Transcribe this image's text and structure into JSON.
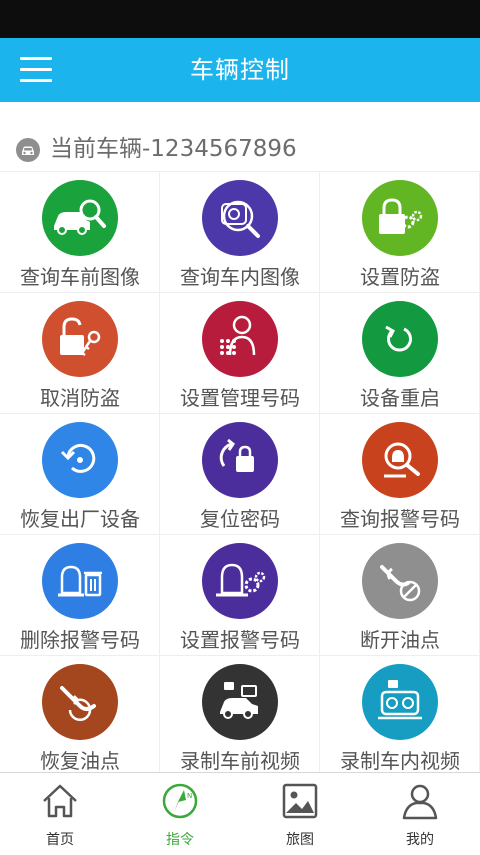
{
  "header": {
    "title": "车辆控制"
  },
  "vehicle": {
    "label": "当前车辆-1234567896"
  },
  "commands": [
    {
      "label": "查询车前图像",
      "icon": "car-magnify-icon",
      "color": "#1aa33c"
    },
    {
      "label": "查询车内图像",
      "icon": "car-interior-search-icon",
      "color": "#4c38a8"
    },
    {
      "label": "设置防盗",
      "icon": "lock-gear-icon",
      "color": "#62b623"
    },
    {
      "label": "取消防盗",
      "icon": "unlock-key-icon",
      "color": "#cf4f2f"
    },
    {
      "label": "设置管理号码",
      "icon": "admin-keypad-icon",
      "color": "#b81c3c"
    },
    {
      "label": "设备重启",
      "icon": "restart-icon",
      "color": "#139a40"
    },
    {
      "label": "恢复出厂设备",
      "icon": "factory-reset-icon",
      "color": "#2f86e6"
    },
    {
      "label": "复位密码",
      "icon": "reset-password-icon",
      "color": "#4b2d9c"
    },
    {
      "label": "查询报警号码",
      "icon": "alarm-search-icon",
      "color": "#c9421e"
    },
    {
      "label": "删除报警号码",
      "icon": "alarm-delete-icon",
      "color": "#2f7ee4"
    },
    {
      "label": "设置报警号码",
      "icon": "alarm-settings-icon",
      "color": "#4b2d9c"
    },
    {
      "label": "断开油点",
      "icon": "fuel-disconnect-icon",
      "color": "#8f8f8f"
    },
    {
      "label": "恢复油点",
      "icon": "fuel-restore-icon",
      "color": "#a4461e"
    },
    {
      "label": "录制车前视频",
      "icon": "front-video-icon",
      "color": "#333333"
    },
    {
      "label": "录制车内视频",
      "icon": "interior-video-icon",
      "color": "#169dc1"
    }
  ],
  "tabs": [
    {
      "label": "首页",
      "icon": "home-icon"
    },
    {
      "label": "指令",
      "icon": "compass-icon",
      "active": true
    },
    {
      "label": "旅图",
      "icon": "gallery-icon"
    },
    {
      "label": "我的",
      "icon": "user-icon"
    }
  ],
  "colors": {
    "primary": "#1bb4ec",
    "active_tab": "#3aa83a",
    "text": "#555555"
  }
}
